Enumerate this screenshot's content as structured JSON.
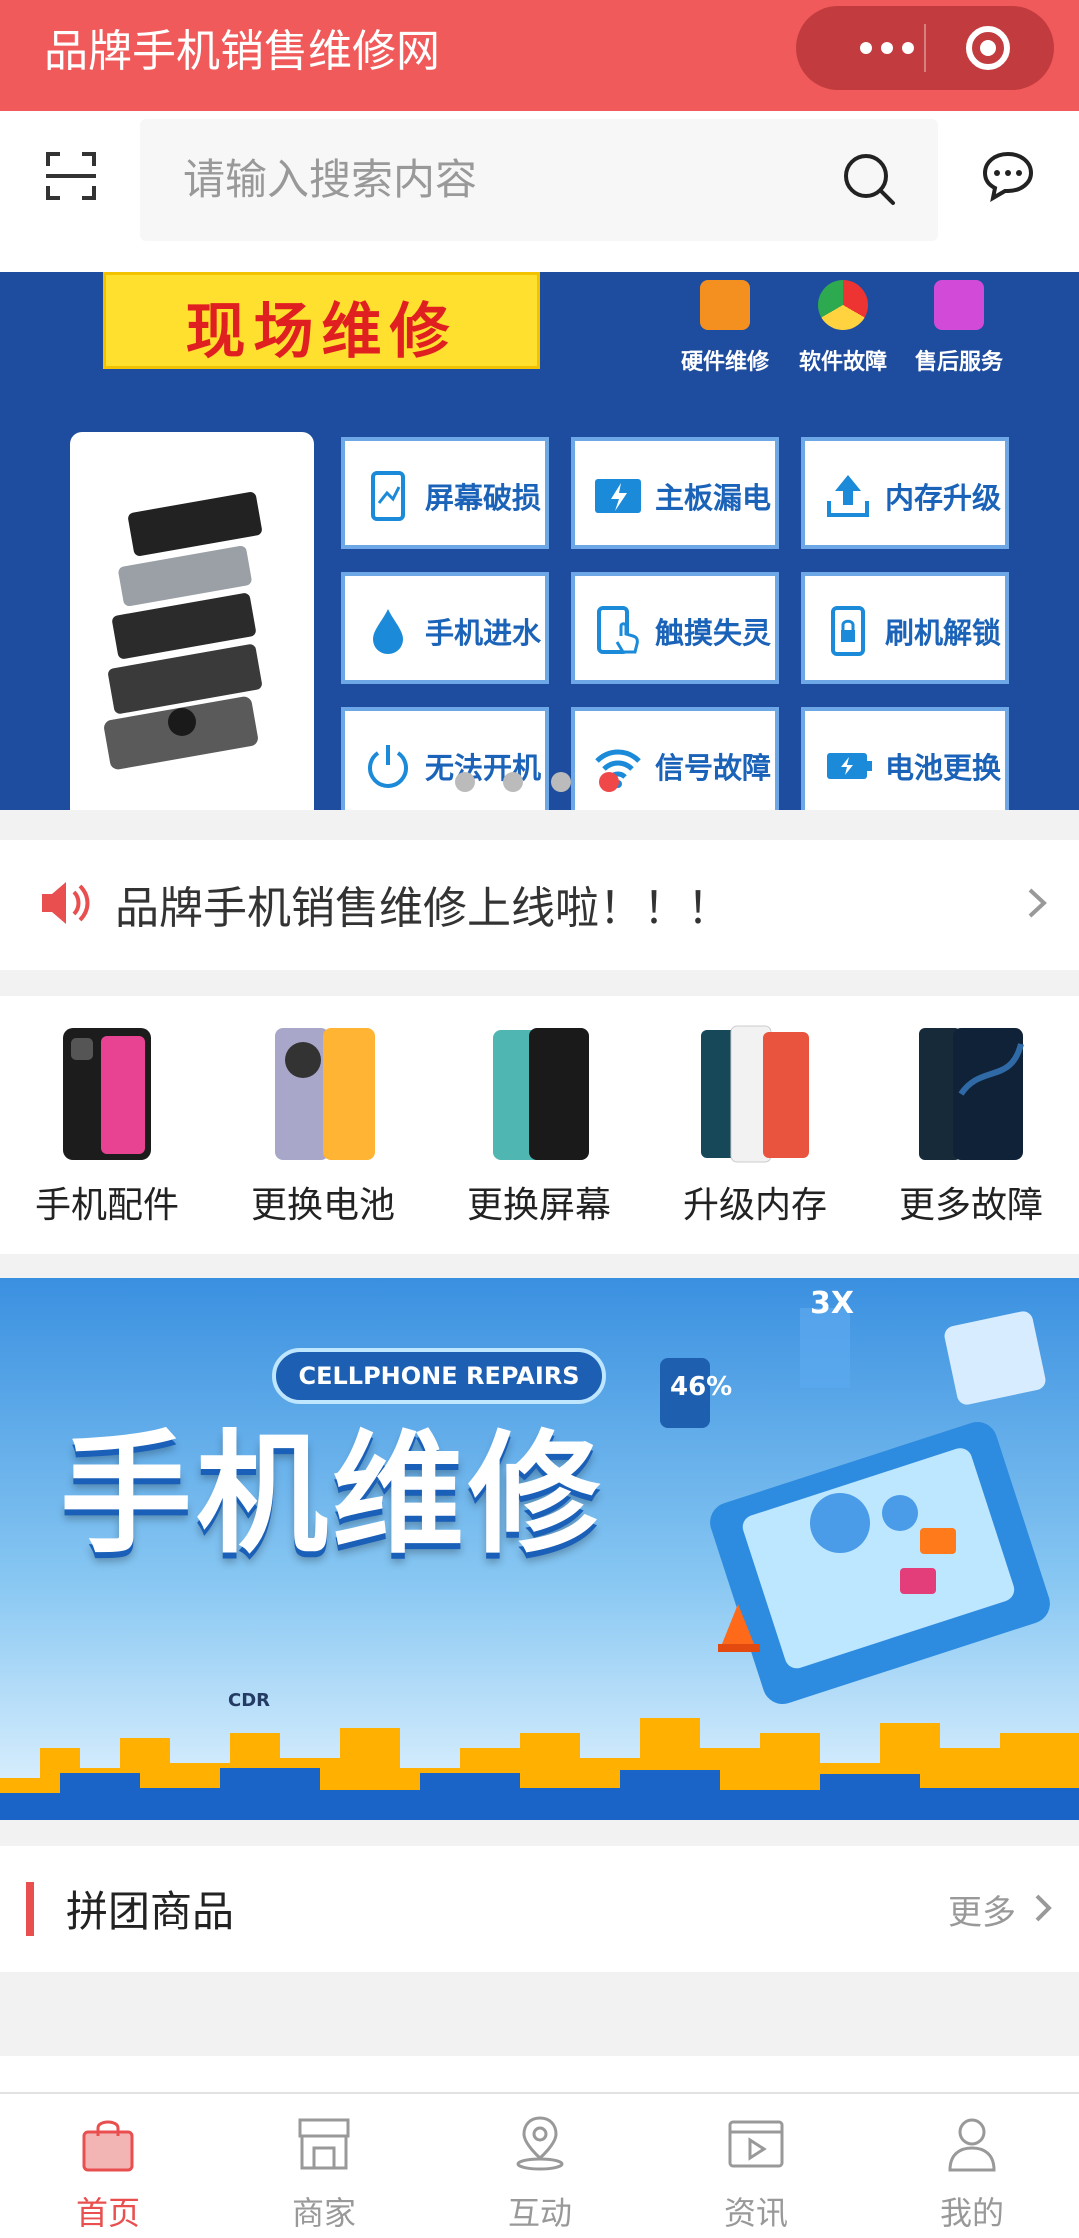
{
  "app": {
    "title": "品牌手机销售维修网"
  },
  "search": {
    "placeholder": "请输入搜索内容"
  },
  "banner1": {
    "headline": "现场维修",
    "top_features": [
      "硬件维修",
      "软件故障",
      "售后服务"
    ],
    "services": [
      "屏幕破损",
      "主板漏电",
      "内存升级",
      "手机进水",
      "触摸失灵",
      "刷机解锁",
      "无法开机",
      "信号故障",
      "电池更换"
    ],
    "carousel": {
      "count": 4,
      "active_index": 3
    }
  },
  "notice": {
    "text": "品牌手机销售维修上线啦！！！"
  },
  "categories": [
    {
      "label": "手机配件"
    },
    {
      "label": "更换电池"
    },
    {
      "label": "更换屏幕"
    },
    {
      "label": "升级内存"
    },
    {
      "label": "更多故障"
    }
  ],
  "banner2": {
    "en_title": "CELLPHONE REPAIRS",
    "cn_title": "手机维修",
    "badge_percent": "46%",
    "badge_3x": "3X",
    "cdr_label": "CDR"
  },
  "group_section": {
    "title": "拼团商品",
    "more_label": "更多"
  },
  "tabbar": {
    "items": [
      {
        "label": "首页",
        "icon": "bag-icon",
        "active": true
      },
      {
        "label": "商家",
        "icon": "store-icon",
        "active": false
      },
      {
        "label": "互动",
        "icon": "location-icon",
        "active": false
      },
      {
        "label": "资讯",
        "icon": "video-icon",
        "active": false
      },
      {
        "label": "我的",
        "icon": "user-icon",
        "active": false
      }
    ]
  },
  "colors": {
    "brand": "#f05a5a",
    "capsule": "#c23c3f",
    "banner_blue": "#1e4c9e",
    "active_tab": "#e94f4f"
  }
}
